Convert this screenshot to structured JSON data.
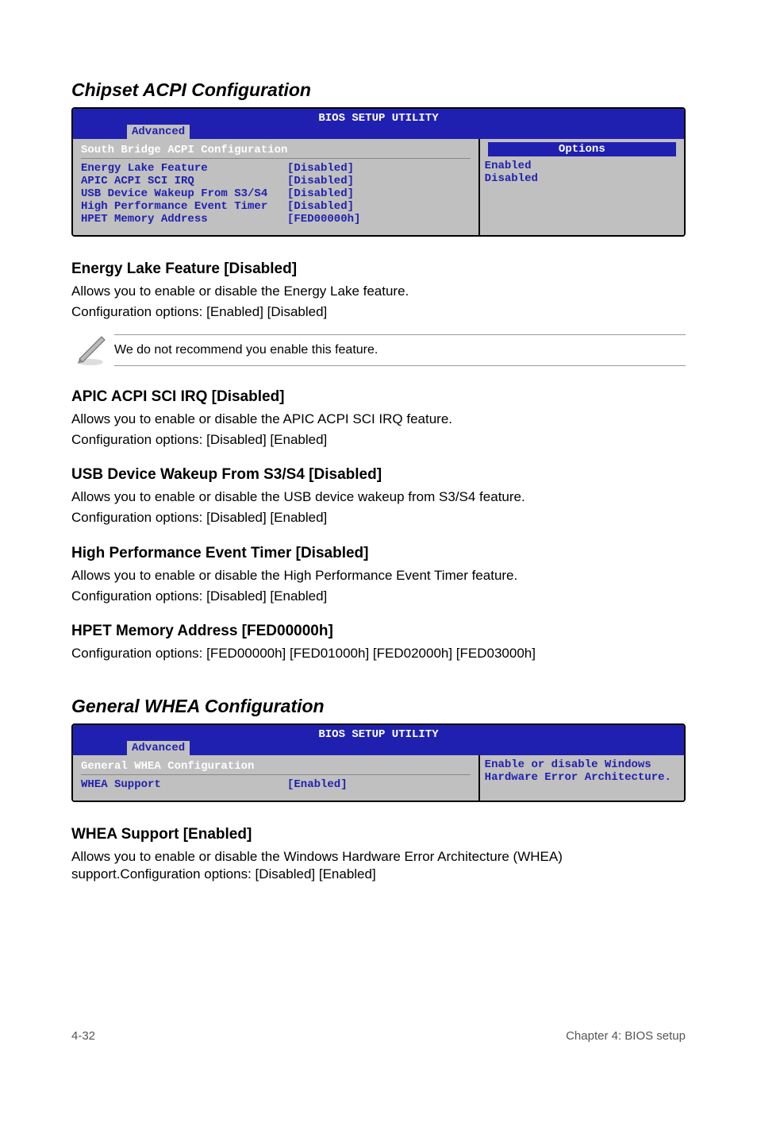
{
  "section1": {
    "title": "Chipset ACPI Configuration",
    "bios": {
      "utility_title": "BIOS SETUP UTILITY",
      "tab": "Advanced",
      "panel_title": "South Bridge ACPI Configuration",
      "rows": [
        {
          "label": "Energy Lake Feature",
          "value": "[Disabled]"
        },
        {
          "label": "APIC ACPI SCI IRQ",
          "value": "[Disabled]"
        },
        {
          "label": "USB Device Wakeup From S3/S4",
          "value": "[Disabled]"
        },
        {
          "label": "High Performance Event Timer",
          "value": "[Disabled]"
        },
        {
          "label": "HPET Memory Address",
          "value": "[FED00000h]"
        }
      ],
      "options_title": "Options",
      "options": [
        "Enabled",
        "Disabled"
      ]
    },
    "items": [
      {
        "heading": "Energy Lake Feature [Disabled]",
        "body1": "Allows you to enable or disable the Energy Lake feature.",
        "body2": "Configuration options: [Enabled] [Disabled]",
        "note": "We do not recommend you enable this feature."
      },
      {
        "heading": "APIC ACPI SCI IRQ [Disabled]",
        "body1": "Allows you to enable or disable the APIC ACPI SCI IRQ feature.",
        "body2": "Configuration options: [Disabled] [Enabled]"
      },
      {
        "heading": "USB Device Wakeup From S3/S4 [Disabled]",
        "body1": "Allows you to enable or disable the USB device wakeup from S3/S4 feature.",
        "body2": "Configuration options: [Disabled] [Enabled]"
      },
      {
        "heading": "High Performance Event Timer [Disabled]",
        "body1": "Allows you to enable or disable the High Performance Event Timer feature.",
        "body2": "Configuration options: [Disabled] [Enabled]"
      },
      {
        "heading": "HPET Memory Address [FED00000h]",
        "body1": "Configuration options: [FED00000h] [FED01000h] [FED02000h] [FED03000h]"
      }
    ]
  },
  "section2": {
    "title": "General WHEA Configuration",
    "bios": {
      "utility_title": "BIOS SETUP UTILITY",
      "tab": "Advanced",
      "panel_title": "General WHEA Configuration",
      "rows": [
        {
          "label": "WHEA Support",
          "value": "[Enabled]"
        }
      ],
      "help": "Enable or disable Windows Hardware Error Architecture."
    },
    "items": [
      {
        "heading": "WHEA Support [Enabled]",
        "body1": "Allows you to enable or disable the Windows Hardware Error Architecture (WHEA) support.Configuration options: [Disabled] [Enabled]"
      }
    ]
  },
  "footer": {
    "left": "4-32",
    "right": "Chapter 4: BIOS setup"
  }
}
